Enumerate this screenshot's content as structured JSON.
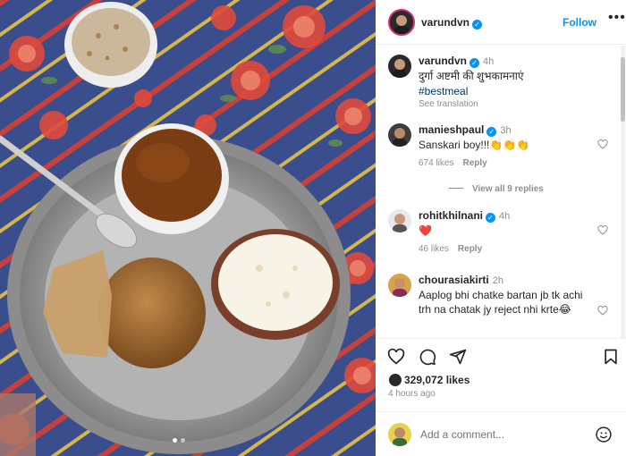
{
  "post": {
    "author": "varundvn",
    "follow_label": "Follow",
    "more_label": "•••",
    "caption_time": "4h",
    "caption_text": "दुर्गा अष्टमी की शुभकामनाएं",
    "caption_tag": "#bestmeal",
    "see_translation": "See translation",
    "likes": "329,072 likes",
    "posted_ago": "4 hours ago",
    "image_alt": "Plate of puri, chana curry and kheer",
    "carousel_dots": 2,
    "carousel_active": 1
  },
  "comments": [
    {
      "user": "manieshpaul",
      "verified": true,
      "time": "3h",
      "text": "Sanskari boy!!!👏👏👏",
      "likes": "674 likes",
      "reply_label": "Reply",
      "view_replies": "View all 9 replies"
    },
    {
      "user": "rohitkhilnani",
      "verified": true,
      "time": "4h",
      "text": "❤️",
      "likes": "46 likes",
      "reply_label": "Reply"
    },
    {
      "user": "chourasiakirti",
      "verified": false,
      "time": "2h",
      "text": "Aaplog bhi chatke bartan jb tk achi trh na chatak jy reject nhi krte😂"
    }
  ],
  "add_comment": {
    "placeholder": "Add a comment..."
  },
  "icons": [
    "heart-icon",
    "comment-icon",
    "share-icon",
    "bookmark-icon",
    "emoji-icon",
    "verified-icon"
  ],
  "colors": {
    "accent": "#0095f6",
    "heart_red": "#ed4956",
    "text": "#262626",
    "muted": "#8e8e8e"
  }
}
